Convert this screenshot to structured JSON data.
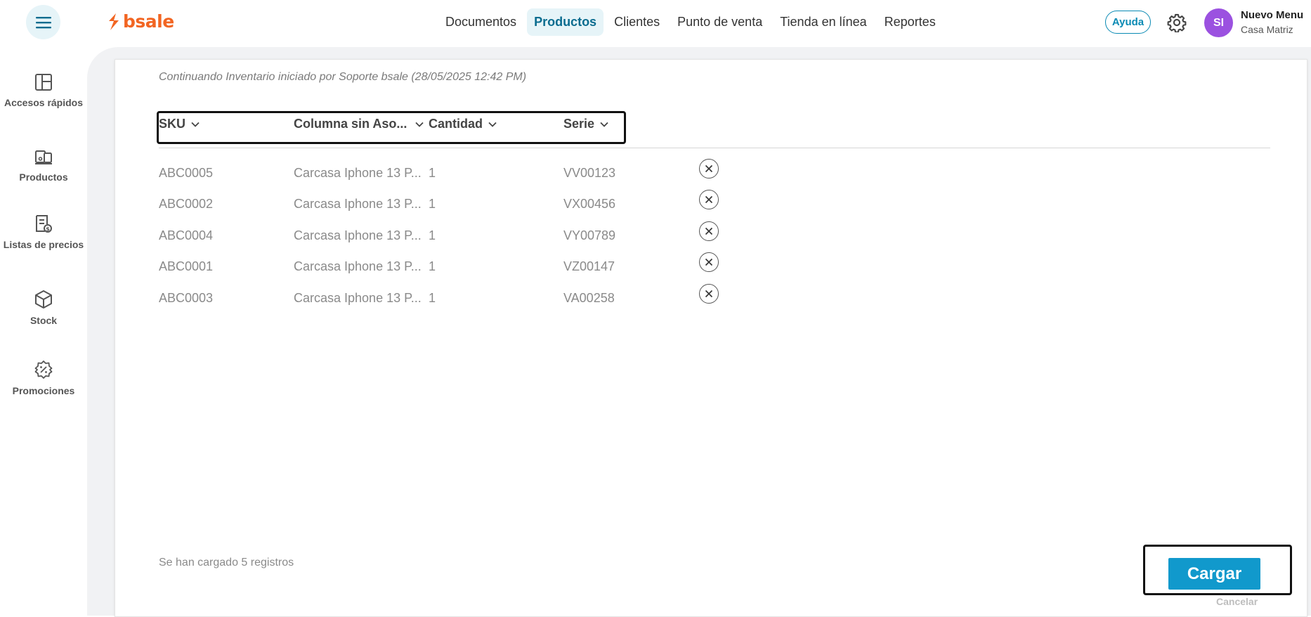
{
  "header": {
    "brand": "bsale",
    "nav": [
      "Documentos",
      "Productos",
      "Clientes",
      "Punto de venta",
      "Tienda en línea",
      "Reportes"
    ],
    "active_nav": "Productos",
    "help_label": "Ayuda",
    "user": {
      "initials": "SI",
      "name": "Nuevo Menu",
      "branch": "Casa Matriz"
    }
  },
  "sidebar": {
    "items": [
      {
        "label": "Accesos rápidos",
        "icon": "quick-access-icon"
      },
      {
        "label": "Productos",
        "icon": "products-icon"
      },
      {
        "label": "Listas de precios",
        "icon": "price-list-icon"
      },
      {
        "label": "Stock",
        "icon": "box-icon"
      },
      {
        "label": "Promociones",
        "icon": "promotion-badge-icon"
      }
    ]
  },
  "main": {
    "subtitle": "Continuando Inventario iniciado por Soporte bsale (28/05/2025 12:42 PM)",
    "columns": [
      "SKU",
      "Columna sin Aso...",
      "Cantidad",
      "Serie"
    ],
    "rows": [
      {
        "sku": "ABC0005",
        "product": "Carcasa Iphone 13 P...",
        "qty": "1",
        "serial": "VV00123"
      },
      {
        "sku": "ABC0002",
        "product": "Carcasa Iphone 13 P...",
        "qty": "1",
        "serial": "VX00456"
      },
      {
        "sku": "ABC0004",
        "product": "Carcasa Iphone 13 P...",
        "qty": "1",
        "serial": "VY00789"
      },
      {
        "sku": "ABC0001",
        "product": "Carcasa Iphone 13 P...",
        "qty": "1",
        "serial": "VZ00147"
      },
      {
        "sku": "ABC0003",
        "product": "Carcasa Iphone 13 P...",
        "qty": "1",
        "serial": "VA00258"
      }
    ],
    "count_label": "Se han cargado 5 registros",
    "submit_label": "Cargar",
    "cancel_label": "Cancelar"
  },
  "colors": {
    "accent": "#1199cc",
    "brand": "#f26522",
    "avatar": "#9b51e0"
  }
}
